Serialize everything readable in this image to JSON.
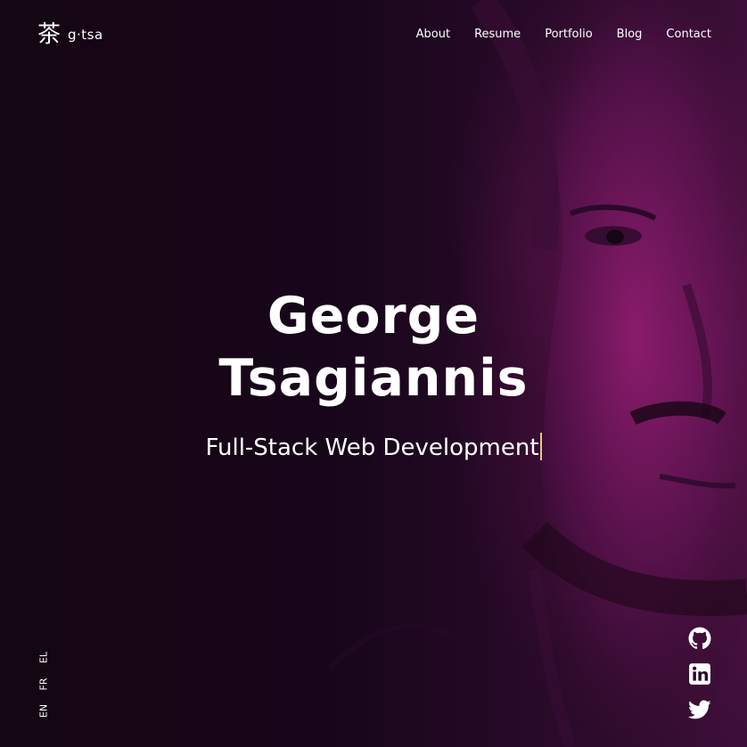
{
  "logo": {
    "mark": "茶",
    "text": "g·tsa"
  },
  "nav": {
    "items": [
      "About",
      "Resume",
      "Portfolio",
      "Blog",
      "Contact"
    ]
  },
  "hero": {
    "name_line1": "George",
    "name_line2": "Tsagiannis",
    "tagline": "Full-Stack Web Development"
  },
  "languages": [
    "EL",
    "FR",
    "EN"
  ],
  "social": [
    "github-icon",
    "linkedin-icon",
    "twitter-icon"
  ],
  "colors": {
    "background": "#150613",
    "accent": "#a01e78",
    "cursor": "#e8c19a"
  }
}
